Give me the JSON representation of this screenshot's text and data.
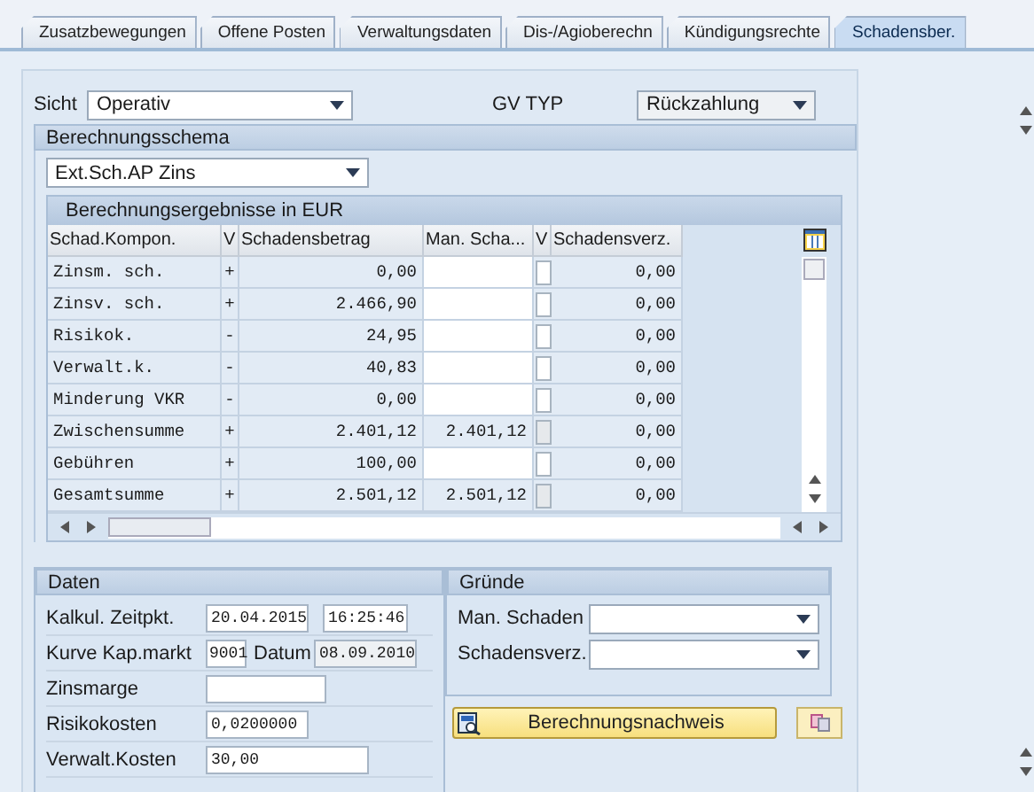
{
  "tabs": [
    {
      "label": "Zusatzbewegungen",
      "selected": false
    },
    {
      "label": "Offene Posten",
      "selected": false
    },
    {
      "label": "Verwaltungsdaten",
      "selected": false
    },
    {
      "label": "Dis-/Agioberechn",
      "selected": false
    },
    {
      "label": "Kündigungsrechte",
      "selected": false
    },
    {
      "label": "Schadensber.",
      "selected": true
    }
  ],
  "sicht": {
    "label": "Sicht",
    "value": "Operativ"
  },
  "gv_typ": {
    "label": "GV TYP",
    "value": "Rückzahlung"
  },
  "schema": {
    "title": "Berechnungsschema",
    "value": "Ext.Sch.AP Zins"
  },
  "table": {
    "title": "Berechnungsergebnisse in EUR",
    "columns": [
      "Schad.Kompon.",
      "V",
      "Schadensbetrag",
      "Man. Scha...",
      "V",
      "Schadensverz."
    ],
    "rows": [
      {
        "component": "Zinsm. sch.",
        "sign": "+",
        "amount": "0,00",
        "manual": "",
        "editable": true,
        "checked": false,
        "waiver": "0,00"
      },
      {
        "component": "Zinsv. sch.",
        "sign": "+",
        "amount": "2.466,90",
        "manual": "",
        "editable": true,
        "checked": false,
        "waiver": "0,00"
      },
      {
        "component": "Risikok.",
        "sign": "-",
        "amount": "24,95",
        "manual": "",
        "editable": true,
        "checked": false,
        "waiver": "0,00"
      },
      {
        "component": "Verwalt.k.",
        "sign": "-",
        "amount": "40,83",
        "manual": "",
        "editable": true,
        "checked": false,
        "waiver": "0,00"
      },
      {
        "component": "Minderung VKR",
        "sign": "-",
        "amount": "0,00",
        "manual": "",
        "editable": true,
        "checked": false,
        "waiver": "0,00"
      },
      {
        "component": "Zwischensumme",
        "sign": "+",
        "amount": "2.401,12",
        "manual": "2.401,12",
        "editable": false,
        "checked": false,
        "waiver": "0,00"
      },
      {
        "component": "Gebühren",
        "sign": "+",
        "amount": "100,00",
        "manual": "",
        "editable": true,
        "checked": false,
        "waiver": "0,00"
      },
      {
        "component": "Gesamtsumme",
        "sign": "+",
        "amount": "2.501,12",
        "manual": "2.501,12",
        "editable": false,
        "checked": false,
        "waiver": "0,00"
      }
    ]
  },
  "daten": {
    "title": "Daten",
    "kalkul": {
      "label": "Kalkul. Zeitpkt.",
      "date": "20.04.2015",
      "time": "16:25:46"
    },
    "kurve": {
      "label": "Kurve Kap.markt",
      "value": "9001",
      "datum_label": "Datum",
      "datum": "08.09.2010"
    },
    "zinsmarge": {
      "label": "Zinsmarge"
    },
    "risikokosten": {
      "label": "Risikokosten",
      "value": "0,0200000"
    },
    "verwalt": {
      "label": "Verwalt.Kosten",
      "value": "30,00"
    }
  },
  "gruende": {
    "title": "Gründe",
    "fields": [
      {
        "label": "Man. Schaden"
      },
      {
        "label": "Schadensverz."
      }
    ]
  },
  "button": {
    "label": "Berechnungsnachweis"
  }
}
